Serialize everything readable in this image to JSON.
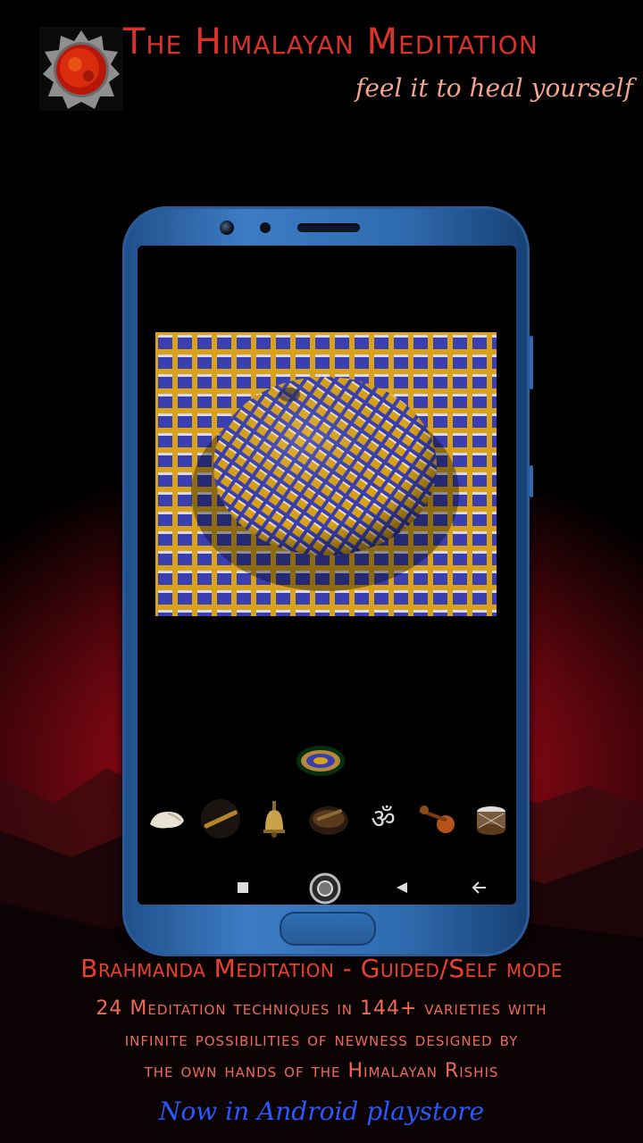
{
  "header": {
    "title": "The Himalayan Meditation",
    "tagline": "feel it to heal yourself",
    "logo_icon": "sun-mandala-logo"
  },
  "phone": {
    "screen": {
      "main_image": "optical-illusion-sphere",
      "selected_icon": "lotus-icon",
      "instruments": [
        {
          "name": "conch-shell-icon"
        },
        {
          "name": "flute-icon"
        },
        {
          "name": "bell-icon"
        },
        {
          "name": "singing-bowl-icon"
        },
        {
          "name": "om-icon"
        },
        {
          "name": "veena-icon"
        },
        {
          "name": "drum-icon"
        }
      ],
      "navbar": {
        "recent": "square-icon",
        "home": "home-circle-icon",
        "back": "back-triangle-icon",
        "arrow": "arrow-left-icon"
      }
    }
  },
  "footer": {
    "headline": "Brahmanda Meditation - Guided/Self mode",
    "description_lines": [
      "24 Meditation techniques in 144+ varieties with",
      "infinite possibilities of newness designed by",
      "the own hands of the Himalayan Rishis"
    ],
    "cta": "Now in Android playstore"
  },
  "colors": {
    "title": "#d8332b",
    "tagline": "#f2a48c",
    "headline": "#e8412f",
    "cta": "#2c57ff",
    "phone_body": "#2e6aad",
    "illusion_blue": "#3a3fb0",
    "illusion_gold": "#d9a21a"
  }
}
